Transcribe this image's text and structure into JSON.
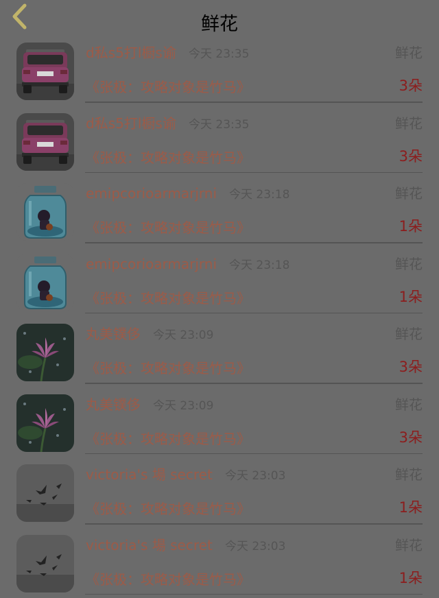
{
  "header": {
    "title": "鲜花",
    "back_icon": "chevron-left-icon",
    "back_color": "#c1b46a"
  },
  "rows": [
    {
      "name": "d私s5打l橱s谕",
      "time": "今天 23:35",
      "type": "鲜花",
      "book": "《张极：攻略对象是竹马》",
      "count": "3朵",
      "avatar": "pink-car"
    },
    {
      "name": "d私s5打l橱s谕",
      "time": "今天 23:35",
      "type": "鲜花",
      "book": "《张极：攻略对象是竹马》",
      "count": "3朵",
      "avatar": "pink-car"
    },
    {
      "name": "emipcorioarmarjrni",
      "time": "今天 23:18",
      "type": "鲜花",
      "book": "《张极：攻略对象是竹马》",
      "count": "1朵",
      "avatar": "glass-jar"
    },
    {
      "name": "emipcorioarmarjrni",
      "time": "今天 23:18",
      "type": "鲜花",
      "book": "《张极：攻略对象是竹马》",
      "count": "1朵",
      "avatar": "glass-jar"
    },
    {
      "name": "丸美镤侈",
      "time": "今天 23:09",
      "type": "鲜花",
      "book": "《张极：攻略对象是竹马》",
      "count": "3朵",
      "avatar": "lotus"
    },
    {
      "name": "丸美镤侈",
      "time": "今天 23:09",
      "type": "鲜花",
      "book": "《张极：攻略对象是竹马》",
      "count": "3朵",
      "avatar": "lotus"
    },
    {
      "name": "victoria's 場 secret",
      "time": "今天 23:03",
      "type": "鲜花",
      "book": "《张极：攻略对象是竹马》",
      "count": "1朵",
      "avatar": "birds"
    },
    {
      "name": "victoria's 場 secret",
      "time": "今天 23:03",
      "type": "鲜花",
      "book": "《张极：攻略对象是竹马》",
      "count": "1朵",
      "avatar": "birds"
    }
  ]
}
